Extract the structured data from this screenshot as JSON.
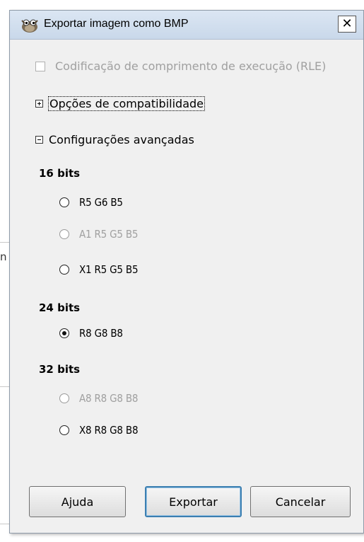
{
  "dialog": {
    "title": "Exportar imagem como BMP",
    "close_symbol": "✕"
  },
  "rle_option": {
    "label": "Codificação de comprimento de execução (RLE)",
    "checked": false,
    "enabled": false
  },
  "compat_expander": {
    "label": "Opções de compatibilidade",
    "expanded": false
  },
  "advanced_expander": {
    "label": "Configurações avançadas",
    "expanded": true
  },
  "groups": {
    "bits16": {
      "title": "16 bits",
      "options": [
        {
          "label": "R5 G6 B5",
          "enabled": true,
          "selected": false
        },
        {
          "label": "A1 R5 G5 B5",
          "enabled": false,
          "selected": false
        },
        {
          "label": "X1 R5 G5 B5",
          "enabled": true,
          "selected": false
        }
      ]
    },
    "bits24": {
      "title": "24 bits",
      "options": [
        {
          "label": "R8 G8 B8",
          "enabled": true,
          "selected": true
        }
      ]
    },
    "bits32": {
      "title": "32 bits",
      "options": [
        {
          "label": "A8 R8 G8 B8",
          "enabled": false,
          "selected": false
        },
        {
          "label": "X8 R8 G8 B8",
          "enabled": true,
          "selected": false
        }
      ]
    }
  },
  "buttons": {
    "help": "Ajuda",
    "export": "Exportar",
    "cancel": "Cancelar"
  },
  "background": {
    "edge_glyph": "n"
  },
  "colors": {
    "accent": "#3c7fb1",
    "disabled_text": "#a0a0a0",
    "titlebar": "#c9d8ea"
  }
}
